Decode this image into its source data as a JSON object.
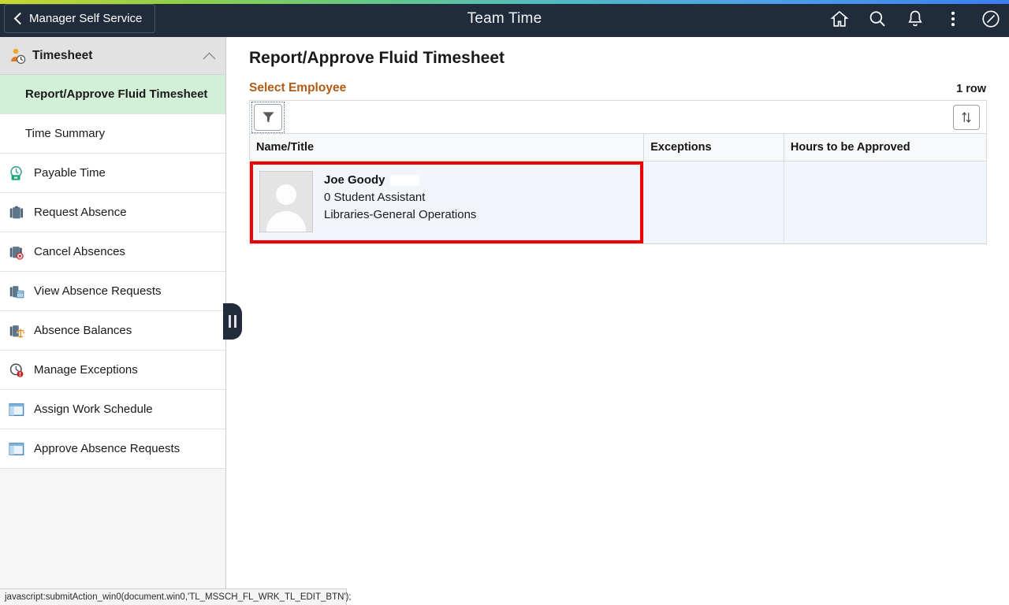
{
  "header": {
    "back_label": "Manager Self Service",
    "title": "Team Time",
    "icons": [
      {
        "name": "home-icon",
        "label": "Home"
      },
      {
        "name": "search-icon",
        "label": "Search"
      },
      {
        "name": "notifications-bell-icon",
        "label": "Notifications"
      },
      {
        "name": "actions-list-icon",
        "label": "Actions List"
      },
      {
        "name": "navbar-compass-icon",
        "label": "NavBar"
      }
    ],
    "background_color": "#202b3b",
    "gradient_colors": [
      "#c8d92b",
      "#63c68a",
      "#3d7ef0"
    ]
  },
  "sidebar": {
    "group": {
      "title": "Timesheet",
      "icon": "person-clock-icon",
      "expanded": true,
      "chevron": "chevron-up-icon"
    },
    "sub_items": [
      {
        "label": "Report/Approve Fluid Timesheet",
        "selected": true
      },
      {
        "label": "Time Summary",
        "selected": false
      }
    ],
    "items": [
      {
        "label": "Payable Time",
        "icon": "payable-time-icon"
      },
      {
        "label": "Request Absence",
        "icon": "briefcase-icon"
      },
      {
        "label": "Cancel Absences",
        "icon": "briefcase-cancel-icon"
      },
      {
        "label": "View Absence Requests",
        "icon": "briefcase-calendar-icon"
      },
      {
        "label": "Absence Balances",
        "icon": "briefcase-balance-icon"
      },
      {
        "label": "Manage Exceptions",
        "icon": "clock-alert-icon"
      },
      {
        "label": "Assign Work Schedule",
        "icon": "window-panel-icon"
      },
      {
        "label": "Approve Absence Requests",
        "icon": "window-panel-icon"
      }
    ],
    "selected_background": "#d2f0d7",
    "collapse_handle": "panel-collapse-handle"
  },
  "main": {
    "page_title": "Report/Approve Fluid Timesheet",
    "section_label": "Select Employee",
    "section_label_color": "#b35a14",
    "row_count": "1 row",
    "toolbar": {
      "filter_icon": "filter-funnel-icon",
      "filter_label": "Filter",
      "sort_icon": "sort-arrows-icon",
      "sort_label": "Sort"
    },
    "table": {
      "columns": [
        "Name/Title",
        "Exceptions",
        "Hours to be Approved"
      ],
      "rows": [
        {
          "name": "Joe Goody",
          "name_redacted": true,
          "title": "0 Student Assistant",
          "department": "Libraries-General Operations",
          "exceptions": "",
          "hours_to_be_approved": "",
          "avatar": "employee-photo-placeholder",
          "highlighted": true,
          "highlight_color": "#ee0000"
        }
      ]
    }
  },
  "statusbar": {
    "text": "javascript:submitAction_win0(document.win0,'TL_MSSCH_FL_WRK_TL_EDIT_BTN');"
  }
}
